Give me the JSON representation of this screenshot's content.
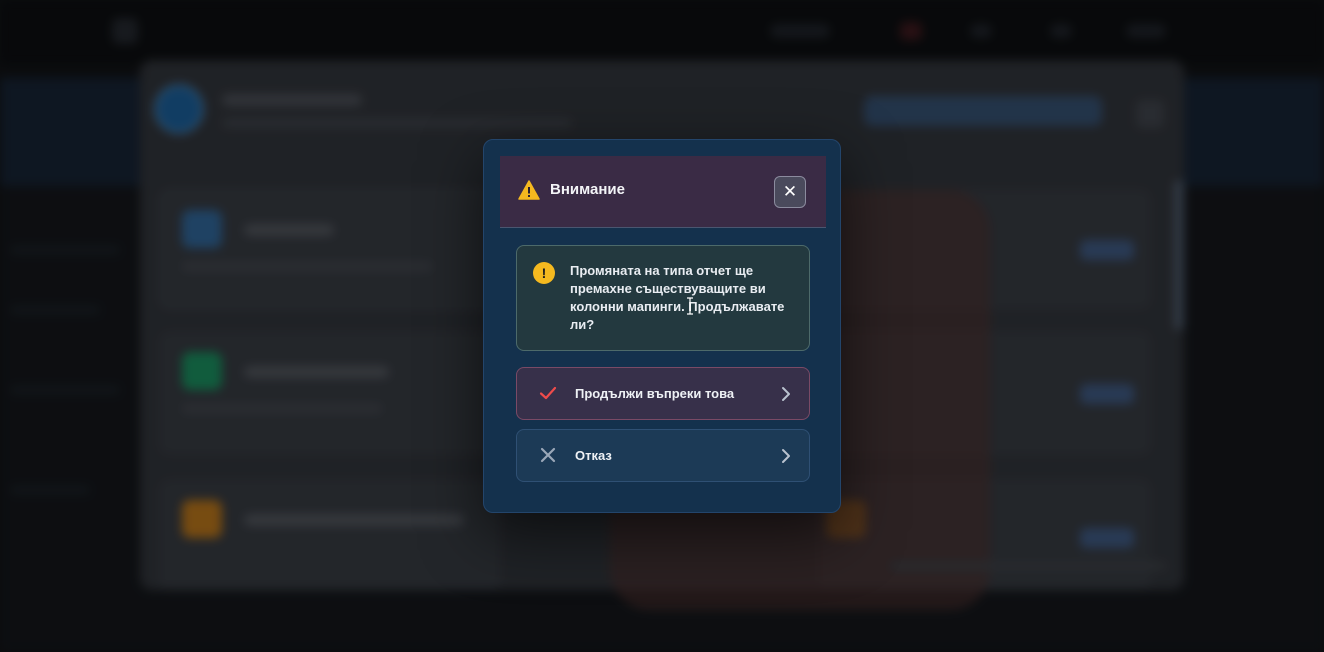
{
  "dialog": {
    "title": "Внимание",
    "close_label": "✕",
    "message": "Промяната на типа отчет ще премахне съществуващите ви колонни мапинги. Продължавате ли?",
    "message_icon": "!",
    "options": [
      {
        "label": "Продължи въпреки това",
        "icon": "check-icon"
      },
      {
        "label": "Отказ",
        "icon": "x-icon"
      }
    ]
  },
  "colors": {
    "dialog_bg": "#14314d",
    "header_bg": "#3a2b45",
    "warning": "#f5b91f",
    "confirm_check": "#ef4b4b",
    "cancel_x": "#9aa7b8"
  }
}
